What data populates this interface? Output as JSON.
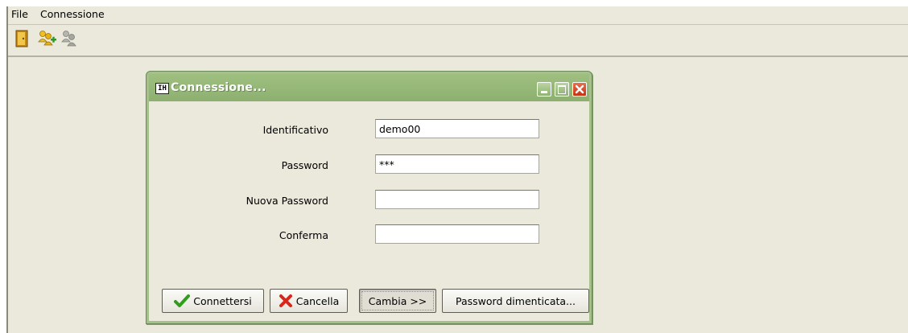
{
  "menubar": {
    "items": [
      "File",
      "Connessione"
    ]
  },
  "toolbar": {
    "icons": [
      "exit-door-icon",
      "add-user-icon",
      "disconnect-icon"
    ]
  },
  "dialog": {
    "title": "Connessione...",
    "fields": {
      "identificativo": {
        "label": "Identificativo",
        "value": "demo00"
      },
      "password": {
        "label": "Password",
        "value": "***"
      },
      "nuova_password": {
        "label": "Nuova Password",
        "value": ""
      },
      "conferma": {
        "label": "Conferma",
        "value": ""
      }
    },
    "buttons": {
      "connect": "Connettersi",
      "cancel": "Cancella",
      "change": "Cambia >>",
      "forgot": "Password dimenticata..."
    }
  },
  "colors": {
    "background": "#ebe8dc",
    "dialog_frame": "#a5c08a",
    "close_button": "#d44521"
  }
}
